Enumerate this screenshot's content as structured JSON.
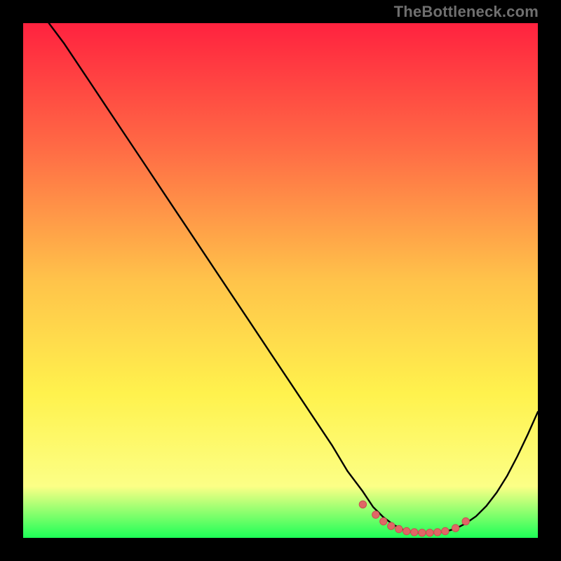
{
  "watermark": "TheBottleneck.com",
  "colors": {
    "frame": "#000000",
    "gradient_top": "#ff223f",
    "gradient_mid_upper": "#ff6a45",
    "gradient_mid": "#ffc34a",
    "gradient_mid_lower": "#fff24d",
    "gradient_lower": "#fcff86",
    "gradient_bottom": "#1dff57",
    "curve": "#000000",
    "marker_fill": "#e06666",
    "marker_stroke": "#c85050"
  },
  "chart_data": {
    "type": "line",
    "title": "",
    "xlabel": "",
    "ylabel": "",
    "xlim": [
      0,
      100
    ],
    "ylim": [
      0,
      100
    ],
    "series": [
      {
        "name": "bottleneck-curve",
        "x": [
          5,
          8,
          12,
          16,
          20,
          24,
          28,
          32,
          36,
          40,
          44,
          48,
          52,
          56,
          60,
          63,
          66,
          68,
          70,
          72,
          74,
          76,
          78,
          80,
          82,
          84,
          86,
          88,
          90,
          92,
          94,
          96,
          98,
          100
        ],
        "y": [
          100,
          96,
          90,
          84,
          78,
          72,
          66,
          60,
          54,
          48,
          42,
          36,
          30,
          24,
          18,
          13,
          9,
          6,
          4,
          2.5,
          1.5,
          1,
          1,
          1,
          1.2,
          1.8,
          2.8,
          4.2,
          6.2,
          8.8,
          12,
          15.8,
          20,
          24.5
        ]
      }
    ],
    "markers": {
      "name": "highlight-dots",
      "x": [
        66,
        68.5,
        70,
        71.5,
        73,
        74.5,
        76,
        77.5,
        79,
        80.5,
        82,
        84,
        86
      ],
      "y": [
        6.5,
        4.5,
        3.2,
        2.3,
        1.7,
        1.3,
        1.1,
        1.0,
        1.0,
        1.1,
        1.3,
        1.9,
        3.2
      ]
    }
  }
}
